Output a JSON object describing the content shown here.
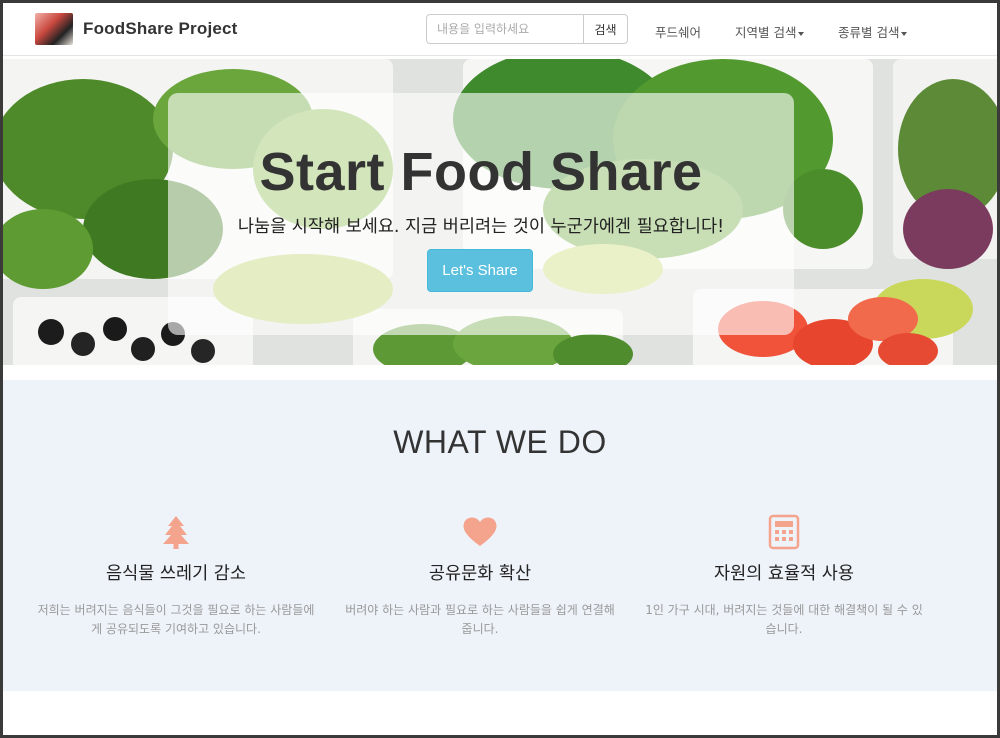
{
  "navbar": {
    "brand": "FoodShare Project",
    "search_placeholder": "내용을 입력하세요",
    "search_button": "검색",
    "links": [
      "푸드쉐어",
      "지역별 검색",
      "종류별 검색"
    ]
  },
  "hero": {
    "title": "Start Food Share",
    "subtitle": "나눔을 시작해 보세요. 지금 버리려는 것이 누군가에겐 필요합니다!",
    "button": "Let's Share"
  },
  "what_we_do": {
    "title": "WHAT WE DO",
    "features": [
      {
        "icon": "tree-icon",
        "heading": "음식물 쓰레기 감소",
        "text": "저희는 버려지는 음식들이 그것을 필요로 하는 사람들에게 공유되도록 기여하고 있습니다."
      },
      {
        "icon": "heart-icon",
        "heading": "공유문화 확산",
        "text": "버려야 하는 사람과 필요로 하는 사람들을 쉽게 연결해 줍니다."
      },
      {
        "icon": "calculator-icon",
        "heading": "자원의 효율적 사용",
        "text": "1인 가구 시대, 버려지는 것들에 대한 해결책이 될 수 있습니다."
      }
    ]
  },
  "colors": {
    "accent": "#5bc0de",
    "icon": "#f4a48c",
    "section_bg": "#eef3fa"
  }
}
